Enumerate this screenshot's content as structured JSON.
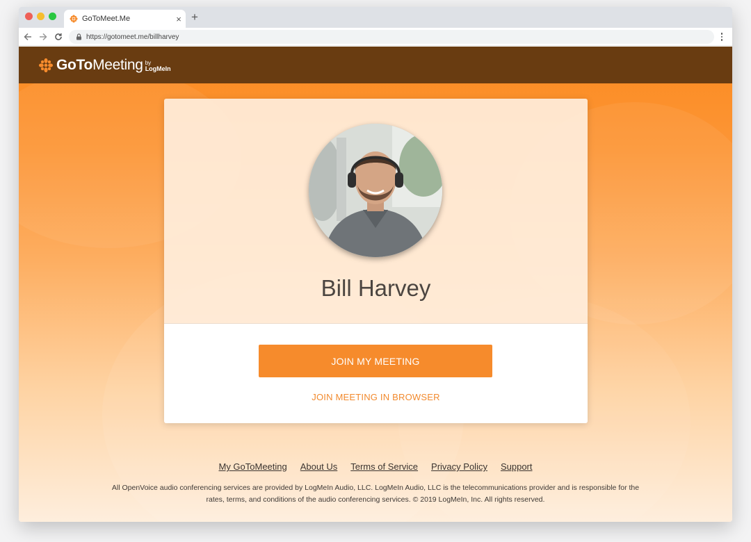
{
  "browser": {
    "tab_title": "GoToMeet.Me",
    "tab_close": "×",
    "new_tab": "+",
    "url": "https://gotomeet.me/billharvey"
  },
  "brand": {
    "logo_goto": "GoTo",
    "logo_meeting": "Meeting",
    "logo_by": "by",
    "logo_logmein": "LogMeIn",
    "accent_color": "#f68b2c",
    "header_color": "#693c11"
  },
  "card": {
    "host_name": "Bill Harvey",
    "join_button": "JOIN MY MEETING",
    "join_browser_link": "JOIN MEETING IN BROWSER"
  },
  "footer": {
    "links": [
      "My GoToMeeting",
      "About Us",
      "Terms of Service",
      "Privacy Policy",
      "Support"
    ],
    "note": "All OpenVoice audio conferencing services are provided by LogMeIn Audio, LLC. LogMeIn Audio, LLC is the telecommunications provider and is responsible for the rates, terms, and conditions of the audio conferencing services. © 2019 LogMeIn, Inc. All rights reserved."
  }
}
